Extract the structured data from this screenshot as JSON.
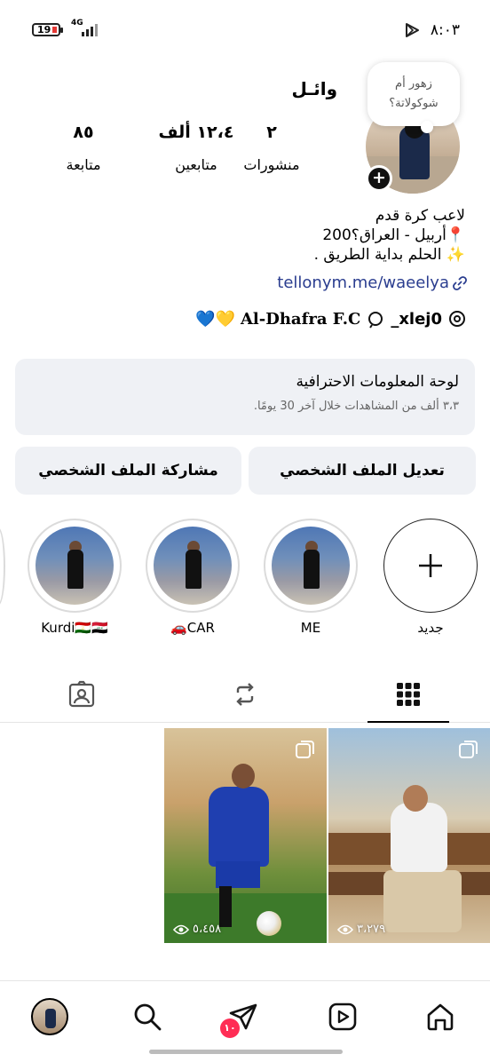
{
  "status_bar": {
    "battery": "19",
    "network": "4G",
    "time": "٨:٠٣"
  },
  "profile": {
    "username": "وائـل",
    "note": "زهور أم شوكولاتة؟",
    "stats": {
      "posts_value": "٢",
      "posts_label": "منشورات",
      "followers_value": "١٢،٤ ألف",
      "followers_label": "متابعين",
      "following_value": "٨٥",
      "following_label": "متابعة"
    },
    "bio_lines": [
      "لاعب كرة قدم",
      "📍أربيل - العراق؟200",
      "✨ الحلم بداية الطريق ."
    ],
    "link": "tellonym.me/waeelya",
    "threads_handle": "_xlej0",
    "club": "Al-Dhafra F.C",
    "club_emoji": "💙💛"
  },
  "dashboard": {
    "title": "لوحة المعلومات الاحترافية",
    "subtitle": "٣،٣ ألف من المشاهدات خلال آخر 30 يومًا."
  },
  "buttons": {
    "edit_profile": "تعديل الملف الشخصي",
    "share_profile": "مشاركة الملف الشخصي"
  },
  "highlights": [
    {
      "label": "جديد"
    },
    {
      "label": "ME"
    },
    {
      "label": "🚗CAR"
    },
    {
      "label": "Kurdi🇹🇯🇮🇶"
    }
  ],
  "posts": [
    {
      "views": "٣،٢٧٩"
    },
    {
      "views": "٥،٤٥٨"
    }
  ],
  "bottom_nav": {
    "dm_badge": "١٠"
  },
  "colors": {
    "link": "#2a3d8f",
    "badge": "#ff2d55",
    "button_bg": "#eff1f5"
  }
}
